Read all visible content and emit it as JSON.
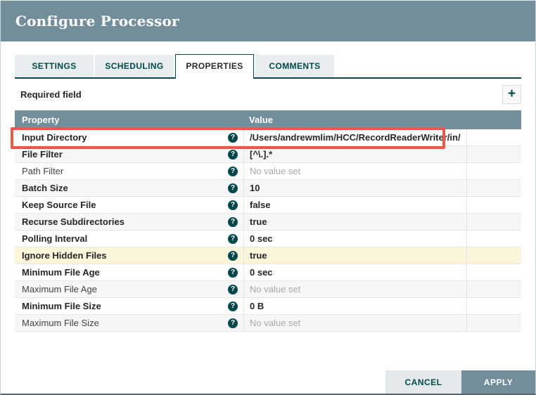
{
  "dialog": {
    "title": "Configure Processor"
  },
  "tabs": [
    {
      "label": "SETTINGS",
      "active": false
    },
    {
      "label": "SCHEDULING",
      "active": false
    },
    {
      "label": "PROPERTIES",
      "active": true
    },
    {
      "label": "COMMENTS",
      "active": false
    }
  ],
  "toolbar": {
    "required_field_label": "Required field",
    "add_symbol": "+"
  },
  "table": {
    "columns": [
      "Property",
      "Value"
    ],
    "help_symbol": "?",
    "rows": [
      {
        "property": "Input Directory",
        "value": "/Users/andrewmlim/HCC/RecordReaderWriter/in/",
        "required": true,
        "unset": false,
        "highlighted": true,
        "selected": false
      },
      {
        "property": "File Filter",
        "value": "[^\\.].*",
        "required": true,
        "unset": false,
        "highlighted": false,
        "selected": false
      },
      {
        "property": "Path Filter",
        "value": "No value set",
        "required": false,
        "unset": true,
        "highlighted": false,
        "selected": false
      },
      {
        "property": "Batch Size",
        "value": "10",
        "required": true,
        "unset": false,
        "highlighted": false,
        "selected": false
      },
      {
        "property": "Keep Source File",
        "value": "false",
        "required": true,
        "unset": false,
        "highlighted": false,
        "selected": false
      },
      {
        "property": "Recurse Subdirectories",
        "value": "true",
        "required": true,
        "unset": false,
        "highlighted": false,
        "selected": false
      },
      {
        "property": "Polling Interval",
        "value": "0 sec",
        "required": true,
        "unset": false,
        "highlighted": false,
        "selected": false
      },
      {
        "property": "Ignore Hidden Files",
        "value": "true",
        "required": true,
        "unset": false,
        "highlighted": false,
        "selected": true
      },
      {
        "property": "Minimum File Age",
        "value": "0 sec",
        "required": true,
        "unset": false,
        "highlighted": false,
        "selected": false
      },
      {
        "property": "Maximum File Age",
        "value": "No value set",
        "required": false,
        "unset": true,
        "highlighted": false,
        "selected": false
      },
      {
        "property": "Minimum File Size",
        "value": "0 B",
        "required": true,
        "unset": false,
        "highlighted": false,
        "selected": false
      },
      {
        "property": "Maximum File Size",
        "value": "No value set",
        "required": false,
        "unset": true,
        "highlighted": false,
        "selected": false
      }
    ]
  },
  "footer": {
    "cancel_label": "CANCEL",
    "apply_label": "APPLY"
  },
  "colors": {
    "header_bg": "#728E9B",
    "teal_accent": "#004849",
    "highlight_red": "#E8584A",
    "selected_row_bg": "#FBF5DC",
    "stripe_bg": "#F4F6F8"
  }
}
